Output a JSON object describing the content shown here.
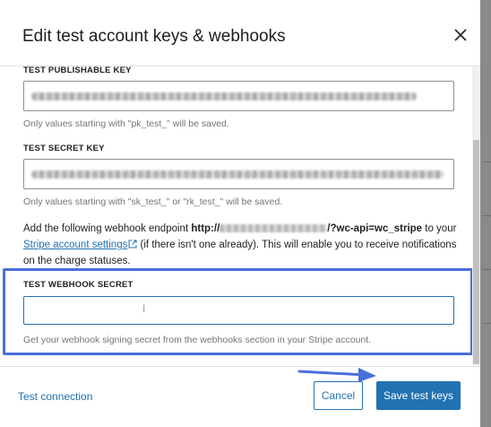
{
  "modal": {
    "title": "Edit test account keys & webhooks"
  },
  "fields": {
    "publishable": {
      "label": "TEST PUBLISHABLE KEY",
      "help": "Only values starting with \"pk_test_\" will be saved."
    },
    "secret": {
      "label": "TEST SECRET KEY",
      "help": "Only values starting with \"sk_test_\" or \"rk_test_\" will be saved."
    },
    "webhook_secret": {
      "label": "TEST WEBHOOK SECRET",
      "value": "",
      "help": "Get your webhook signing secret from the webhooks section in your Stripe account."
    }
  },
  "webhook_description": {
    "prefix": "Add the following webhook endpoint ",
    "endpoint_start": "http://",
    "endpoint_end": "/?wc-api=wc_stripe",
    "middle": " to your ",
    "link_text": "Stripe account settings",
    "suffix": " (if there isn't one already). This will enable you to receive notifications on the charge statuses."
  },
  "footer": {
    "test_connection": "Test connection",
    "cancel": "Cancel",
    "save": "Save test keys"
  },
  "colors": {
    "accent": "#2271b1",
    "highlight": "#4a6fd8"
  },
  "icons": {
    "close": "close-icon",
    "external_link": "external-link-icon",
    "annotation_arrow": "arrow-icon"
  }
}
